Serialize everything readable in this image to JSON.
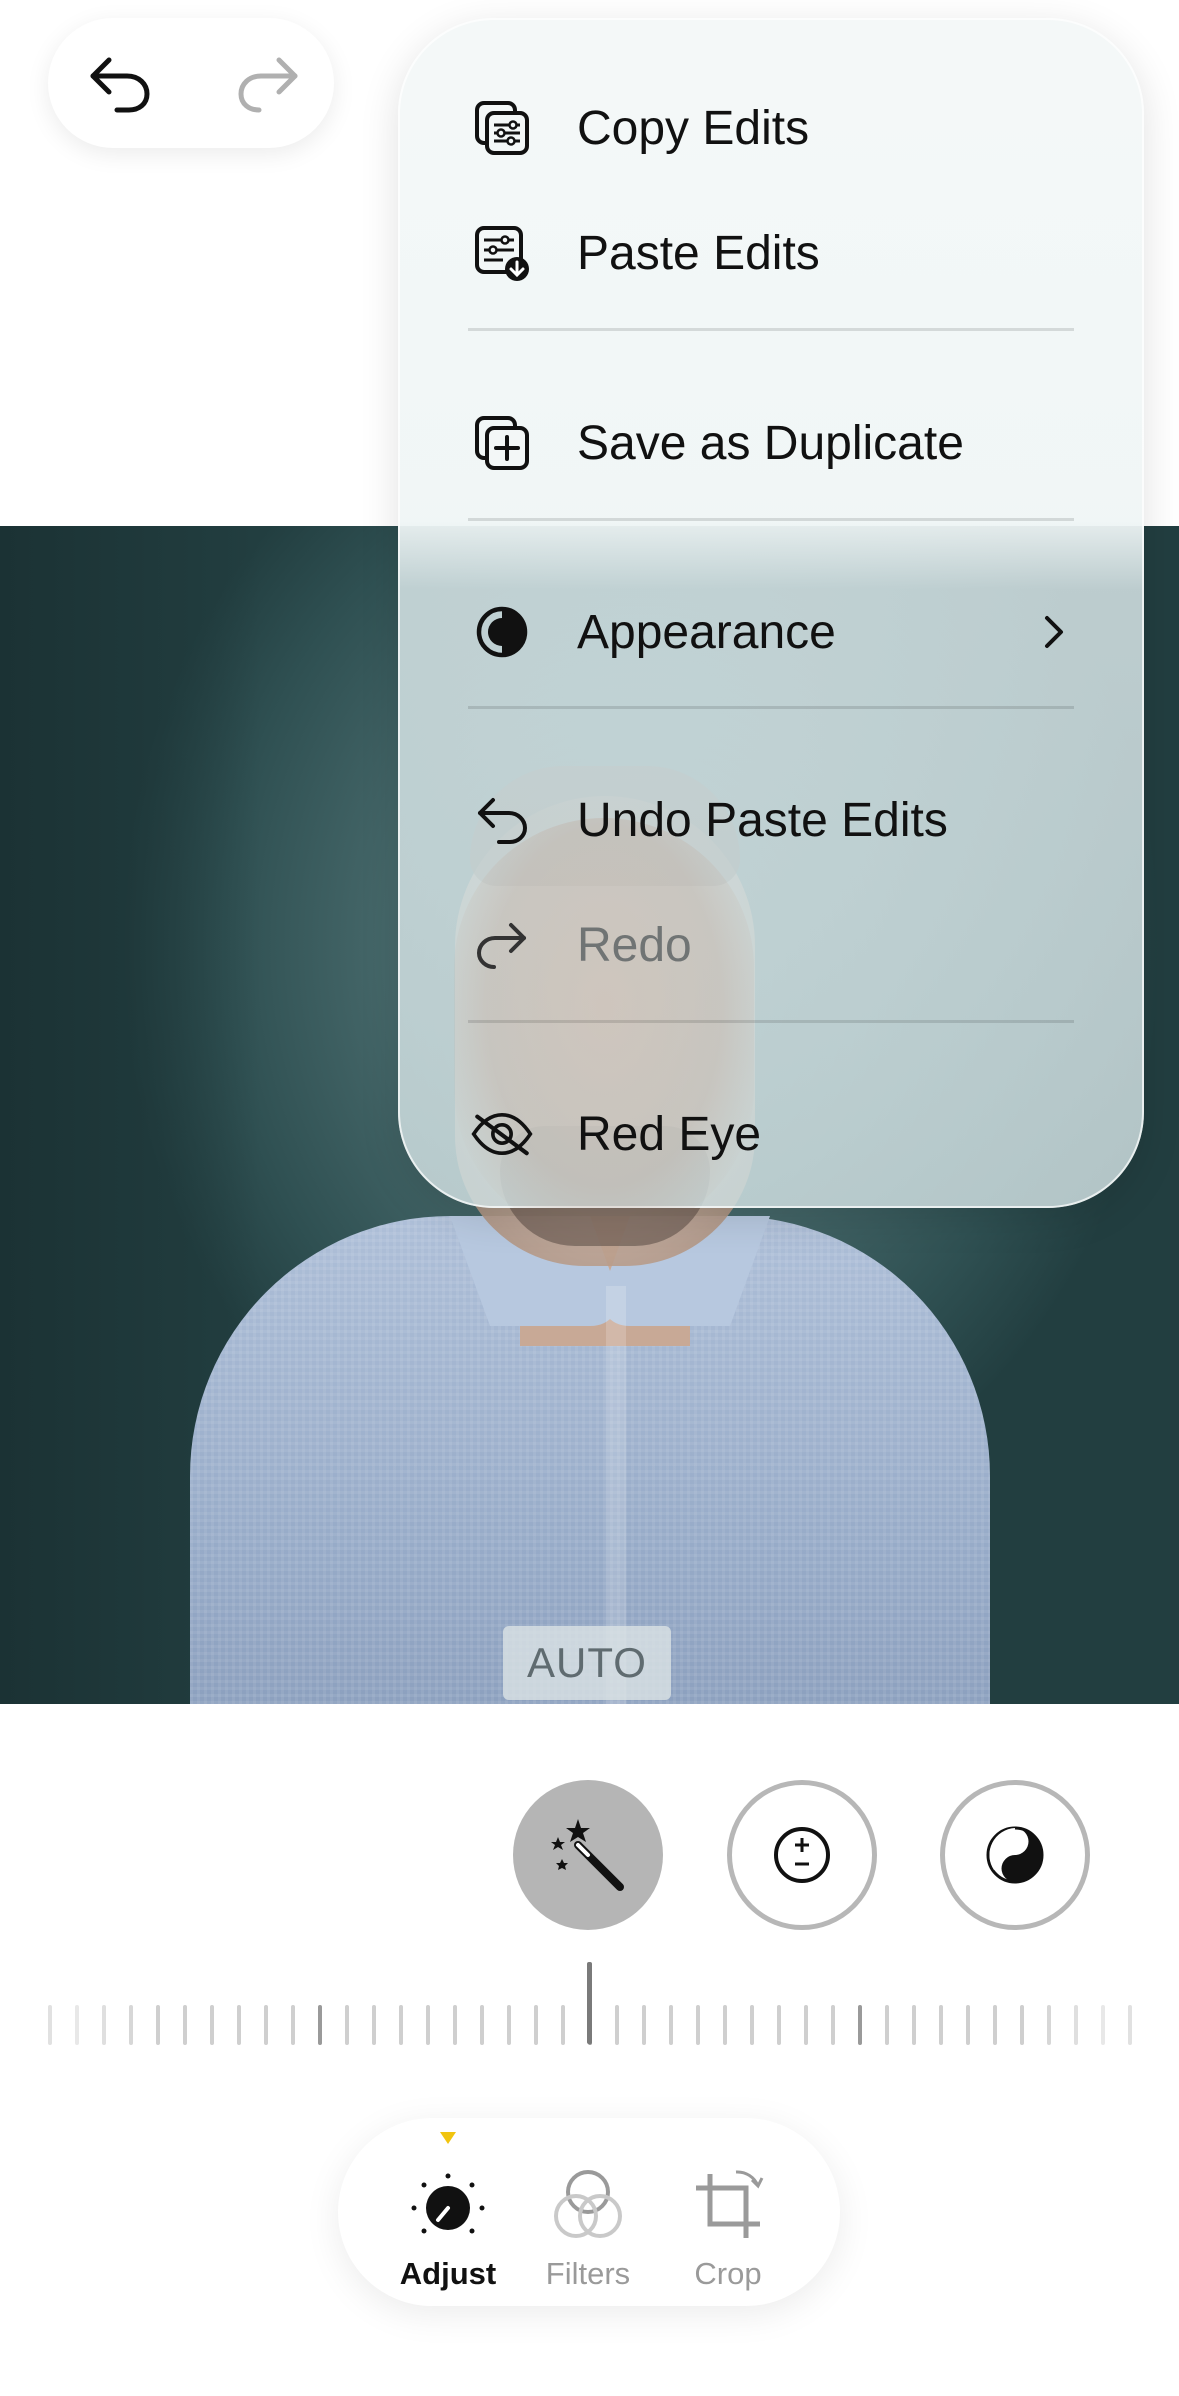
{
  "toolbar": {
    "undo_icon": "undo-arrow-icon",
    "redo_icon": "redo-arrow-icon"
  },
  "menu": {
    "items": [
      {
        "label": "Copy Edits",
        "icon": "copy-edits-icon"
      },
      {
        "label": "Paste Edits",
        "icon": "paste-edits-icon"
      },
      {
        "label": "Save as Duplicate",
        "icon": "duplicate-plus-icon"
      },
      {
        "label": "Appearance",
        "icon": "half-circle-icon",
        "submenu": true
      },
      {
        "label": "Undo Paste Edits",
        "icon": "undo-arrow-icon"
      },
      {
        "label": "Redo",
        "icon": "redo-arrow-icon",
        "disabled": true
      },
      {
        "label": "Red Eye",
        "icon": "eye-slash-icon"
      }
    ]
  },
  "photo": {
    "auto_label": "AUTO"
  },
  "adjust_tools": [
    {
      "name": "auto-enhance",
      "icon": "magic-wand-icon",
      "selected": true
    },
    {
      "name": "exposure",
      "icon": "plus-minus-icon",
      "selected": false
    },
    {
      "name": "brilliance",
      "icon": "yin-yang-icon",
      "selected": false
    }
  ],
  "tabs": [
    {
      "label": "Adjust",
      "active": true
    },
    {
      "label": "Filters",
      "active": false
    },
    {
      "label": "Crop",
      "active": false
    }
  ],
  "colors": {
    "active_indicator": "#f1c40f",
    "menu_text": "#111111",
    "disabled_text": "#707474"
  }
}
